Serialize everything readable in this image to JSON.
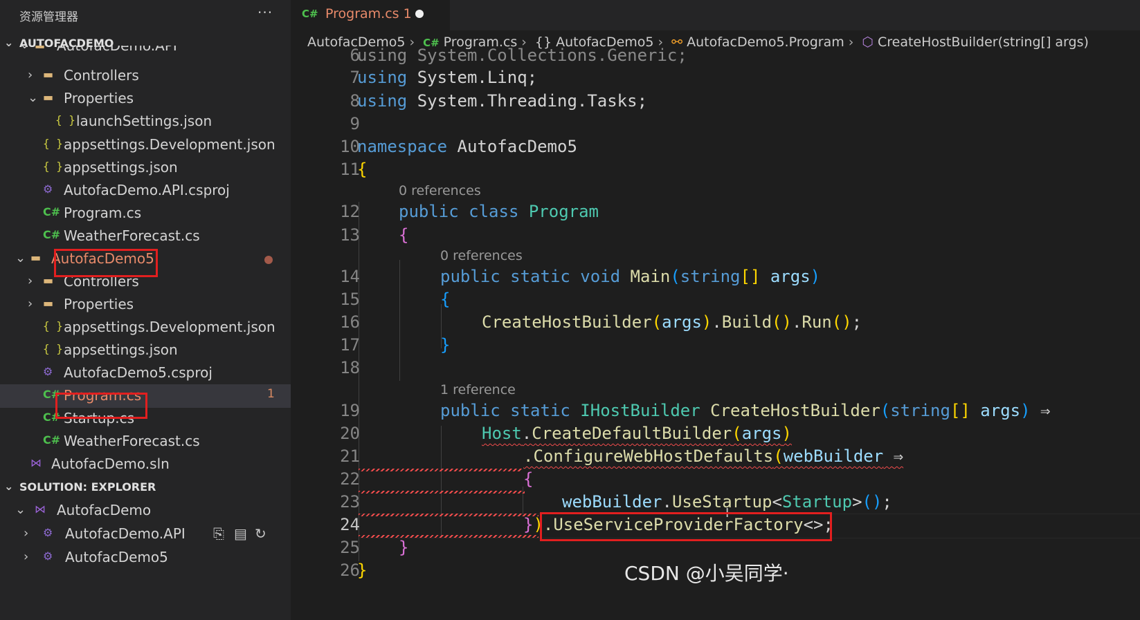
{
  "explorer": {
    "title": "资源管理器",
    "more": "···",
    "workspace": "AUTOFACDEMO",
    "cut_row": "AutofacDemo.API",
    "tree": [
      {
        "name": "Controllers",
        "icon": "folder-icon",
        "twisty": "›"
      },
      {
        "name": "Properties",
        "icon": "folder-icon",
        "twisty": "⌄"
      },
      {
        "name": "launchSettings.json",
        "icon": "json-icon",
        "twisty": ""
      },
      {
        "name": "appsettings.Development.json",
        "icon": "json-icon",
        "twisty": ""
      },
      {
        "name": "appsettings.json",
        "icon": "json-icon",
        "twisty": ""
      },
      {
        "name": "AutofacDemo.API.csproj",
        "icon": "csproj-icon",
        "twisty": ""
      },
      {
        "name": "Program.cs",
        "icon": "csharp-icon",
        "twisty": ""
      },
      {
        "name": "WeatherForecast.cs",
        "icon": "csharp-icon",
        "twisty": ""
      },
      {
        "name": "AutofacDemo5",
        "icon": "folder-open-icon",
        "twisty": "⌄"
      },
      {
        "name": "Controllers",
        "icon": "folder-icon",
        "twisty": "›"
      },
      {
        "name": "Properties",
        "icon": "folder-icon",
        "twisty": "›"
      },
      {
        "name": "appsettings.Development.json",
        "icon": "json-icon",
        "twisty": ""
      },
      {
        "name": "appsettings.json",
        "icon": "json-icon",
        "twisty": ""
      },
      {
        "name": "AutofacDemo5.csproj",
        "icon": "csproj-icon",
        "twisty": ""
      },
      {
        "name": "Program.cs",
        "icon": "csharp-icon",
        "twisty": "",
        "badge": "1"
      },
      {
        "name": "Startup.cs",
        "icon": "csharp-icon",
        "twisty": ""
      },
      {
        "name": "WeatherForecast.cs",
        "icon": "csharp-icon",
        "twisty": ""
      },
      {
        "name": "AutofacDemo.sln",
        "icon": "sln-icon",
        "twisty": ""
      }
    ],
    "solution_header": "SOLUTION: EXPLORER",
    "solution": [
      {
        "name": "AutofacDemo"
      },
      {
        "name": "AutofacDemo.API"
      },
      {
        "name": "AutofacDemo5"
      }
    ]
  },
  "tab": {
    "lang": "C#",
    "label": "Program.cs 1"
  },
  "breadcrumb": {
    "project": "AutofacDemo5",
    "file_lang": "C#",
    "file": "Program.cs",
    "ns_icon": "{}",
    "namespace": "AutofacDemo5",
    "class": "AutofacDemo5.Program",
    "method": "CreateHostBuilder(string[] args)"
  },
  "code": {
    "lines": {
      "l6": "using System.Collections.Generic;",
      "l7_kw": "using",
      "l7_rest": " System.Linq;",
      "l8_kw": "using",
      "l8_rest": " System.Threading.Tasks;",
      "l10_kw": "namespace",
      "l10_rest": " AutofacDemo5",
      "l12_a": "public",
      "l12_b": "class",
      "l12_c": "Program",
      "l14_a": "public static void",
      "l14_fn": "Main",
      "l14_kw": "string",
      "l14_pm": "args",
      "l16_fn": "CreateHostBuilder",
      "l16_pm": "args",
      "l16_b": "Build",
      "l16_r": "Run",
      "l19_a": "public static",
      "l19_ty": "IHostBuilder",
      "l19_fn": "CreateHostBuilder",
      "l19_kw": "string",
      "l19_pm": "args",
      "l19_arrow": "⇒",
      "l20_ty": "Host",
      "l20_fn": "CreateDefaultBuilder",
      "l20_pm": "args",
      "l21_fn": ".ConfigureWebHostDefaults",
      "l21_pm": "webBuilder",
      "l21_arrow": "⇒",
      "l23_pm": "webBuilder",
      "l23_fn": "UseStartup",
      "l23_ty": "Startup",
      "l24_fn": ".UseServiceProviderFactory",
      "l24_gen": "<>"
    },
    "line_numbers": [
      "6",
      "7",
      "8",
      "9",
      "10",
      "11",
      "12",
      "13",
      "14",
      "15",
      "16",
      "17",
      "18",
      "19",
      "20",
      "21",
      "22",
      "23",
      "24",
      "25",
      "26"
    ],
    "lens": {
      "class_refs": "0 references",
      "main_refs": "0 references",
      "chb_refs": "1 reference"
    }
  },
  "watermark": "CSDN @小吴同学·"
}
